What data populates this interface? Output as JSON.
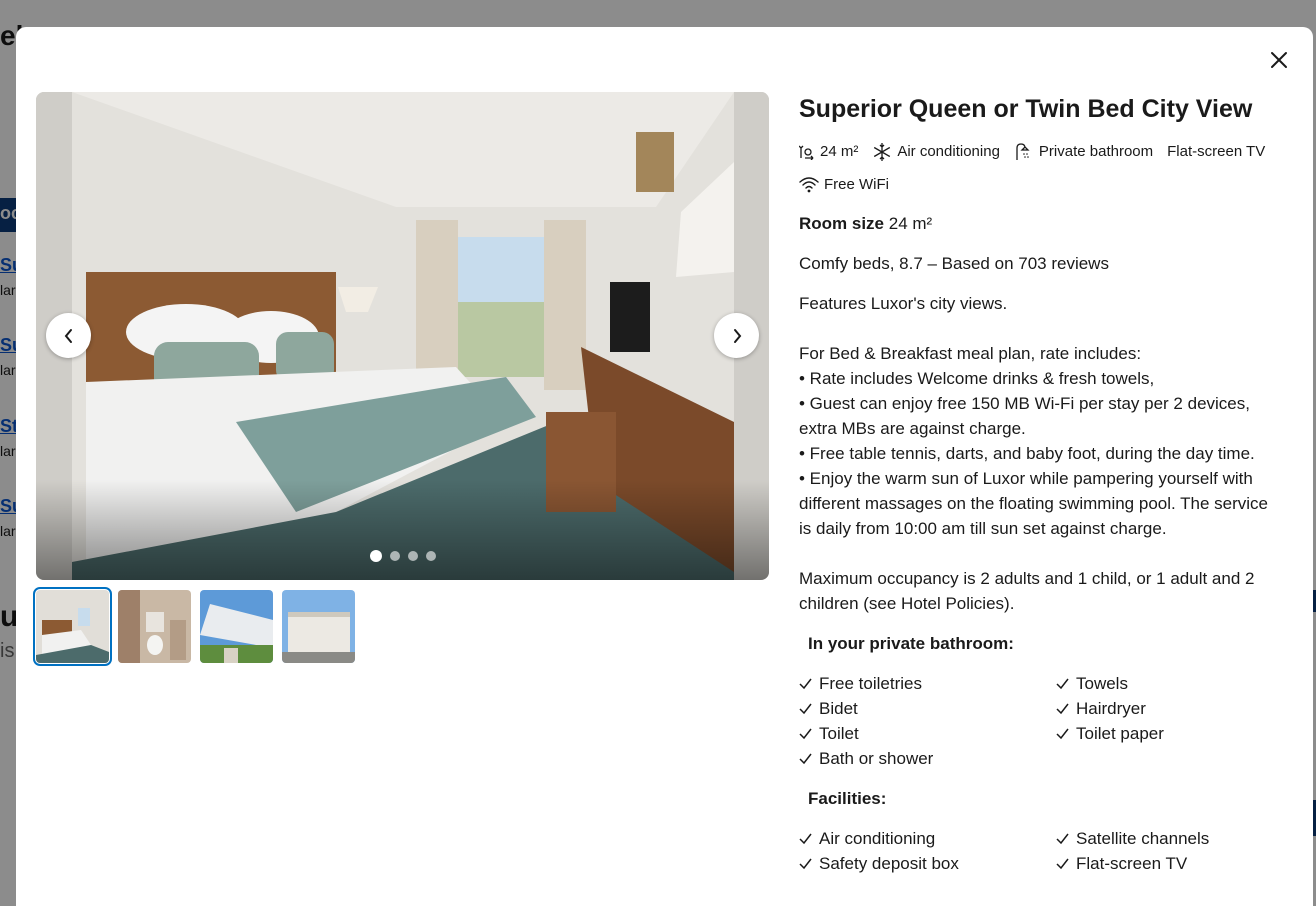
{
  "background": {
    "fragments": [
      "el",
      "Su",
      "lar",
      "Su",
      "lar",
      "St",
      "lar",
      "Su",
      "lar",
      "oc",
      "u",
      "is"
    ]
  },
  "modal": {
    "close_label": "×",
    "room_title": "Superior Queen or Twin Bed City View",
    "facility_chips": [
      {
        "icon": "room-size-icon",
        "label": "24 m²"
      },
      {
        "icon": "snowflake-icon",
        "label": "Air conditioning"
      },
      {
        "icon": "shower-icon",
        "label": "Private bathroom"
      },
      {
        "icon": "",
        "label": "Flat-screen TV"
      },
      {
        "icon": "wifi-icon",
        "label": "Free WiFi"
      }
    ],
    "room_size_label": "Room size",
    "room_size_value": "24 m²",
    "comfy_beds": "Comfy beds, 8.7 – Based on 703 reviews",
    "features": "Features Luxor's city views.",
    "meal_plan_lines": [
      "For Bed & Breakfast meal plan, rate includes:",
      "• Rate includes Welcome drinks & fresh towels,",
      "• Guest can enjoy free 150 MB Wi-Fi per stay per 2 devices, extra MBs are against charge.",
      "• Free table tennis, darts, and baby foot, during the day time.",
      "• Enjoy the warm sun of Luxor while pampering yourself with different massages on the floating swimming pool. The service is daily from 10:00 am till sun set against charge."
    ],
    "occupancy": "Maximum occupancy is 2 adults and 1 child, or 1 adult and 2 children (see Hotel Policies).",
    "bathroom_title": "In your private bathroom:",
    "bathroom_items": [
      "Free toiletries",
      "Towels",
      "Bidet",
      "Hairdryer",
      "Toilet",
      "Toilet paper",
      "Bath or shower"
    ],
    "facilities_title": "Facilities:",
    "facilities_items": [
      "Air conditioning",
      "Satellite channels",
      "Safety deposit box",
      "Flat-screen TV"
    ]
  },
  "gallery": {
    "current_index": 1,
    "dot_count": 4,
    "thumbnails": [
      "bedroom",
      "bathroom",
      "hotel-exterior-pool",
      "hotel-exterior-front"
    ]
  },
  "colors": {
    "accent": "#0071c2",
    "link": "#0b57d0",
    "overlay": "#8a8a8a"
  }
}
